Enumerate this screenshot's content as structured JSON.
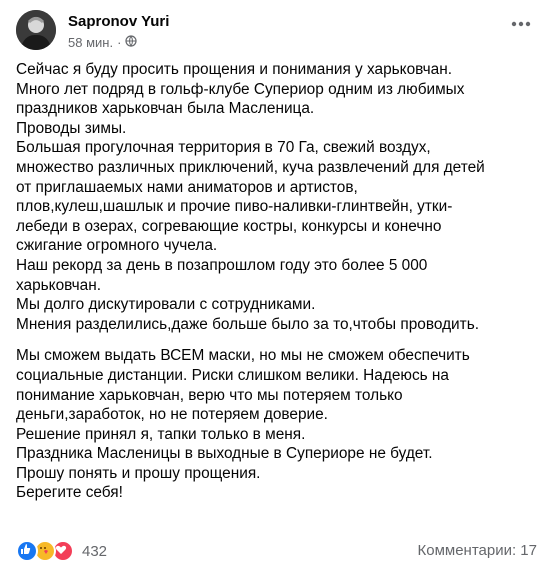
{
  "post": {
    "author": "Sapronov Yuri",
    "time": "58 мин.",
    "separator": "·",
    "privacy_icon": "globe-icon",
    "more_icon": "more-options-icon",
    "lines_part1": [
      "Сейчас я буду просить прощения и понимания у харьковчан.",
      "Много лет подряд в гольф-клубе Супериор одним из любимых",
      "праздников харьковчан была Масленица.",
      "Проводы зимы.",
      "Большая прогулочная территория в 70 Га, свежий воздух,",
      "множество различных приключений, куча развлечений для детей",
      "от приглашаемых нами аниматоров и артистов,",
      "плов,кулеш,шашлык и прочие пиво-наливки-глинтвейн, утки-",
      "лебеди в озерах, согревающие костры, конкурсы и конечно",
      "сжигание огромного чучела.",
      "Наш рекорд за день в позапрошлом году это более 5 000",
      "харьковчан.",
      "Мы долго дискутировали с сотрудниками.",
      "Мнения разделились,даже больше было за то,чтобы проводить."
    ],
    "lines_part2": [
      "Мы сможем выдать ВСЕМ маски, но мы не сможем обеспечить",
      "социальные дистанции. Риски слишком велики. Надеюсь на",
      "понимание харьковчан, верю что мы потеряем только",
      "деньги,заработок, но не потеряем доверие.",
      "Решение принял я, тапки только в меня.",
      "Праздника Масленицы в выходные в Супериоре не будет.",
      "Прошу понять и прошу прощения.",
      "Берегите себя!"
    ]
  },
  "footer": {
    "reactions": [
      {
        "name": "like",
        "icon": "thumbs-up-icon",
        "color": "#1877f2"
      },
      {
        "name": "care",
        "icon": "care-emoji-icon",
        "color": "#f7b928"
      },
      {
        "name": "love",
        "icon": "heart-icon",
        "color": "#f33e58"
      }
    ],
    "reaction_count": "432",
    "comments_label": "Комментарии: 17"
  }
}
